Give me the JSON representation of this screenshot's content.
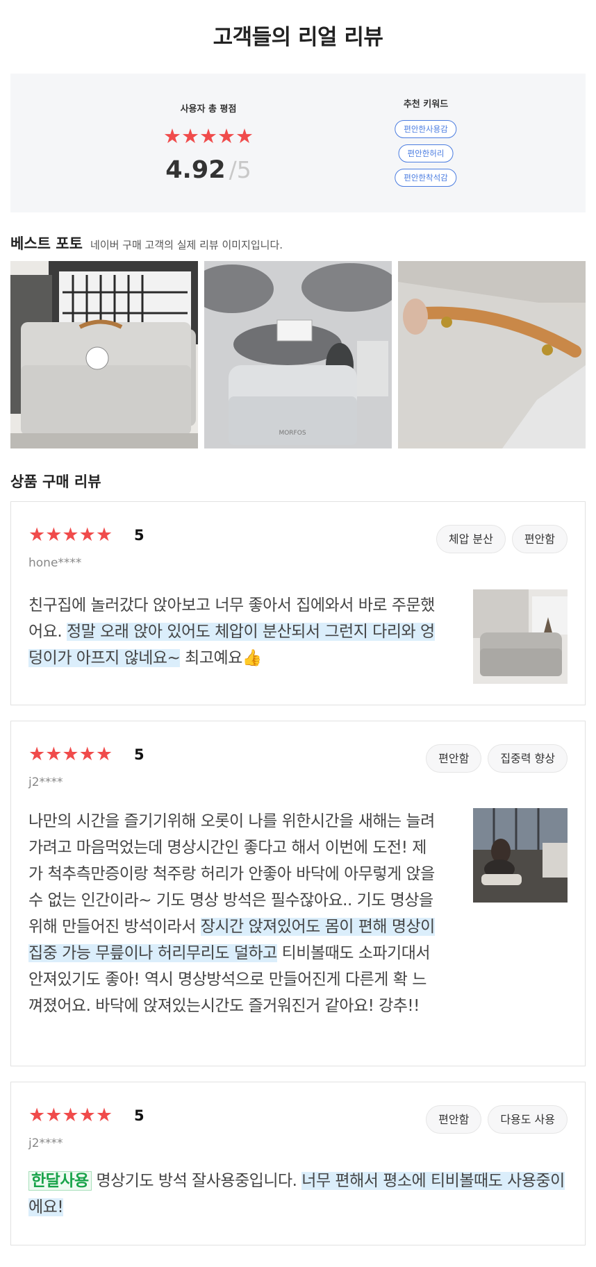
{
  "page": {
    "title": "고객들의 리얼 리뷰"
  },
  "summary": {
    "rating_label": "사용자 총 평점",
    "stars": "★★★★★",
    "score": "4.92",
    "score_sep": "/",
    "score_max": "5",
    "keywords_title": "추천 키워드",
    "keywords": [
      "편안한사용감",
      "편안한허리",
      "편안한착석감"
    ]
  },
  "best_photo": {
    "title": "베스트 포토",
    "subtitle": "네이버 구매 고객의 실제 리뷰 이미지입니다.",
    "photo_brand": "MORFOS"
  },
  "reviews_section": {
    "title": "상품 구매 리뷰"
  },
  "reviews": [
    {
      "stars": "★★★★★",
      "score": "5",
      "user": "hone****",
      "tags": [
        "체압 분산",
        "편안함"
      ],
      "text_plain_1": "친구집에 놀러갔다 앉아보고 너무 좋아서 집에와서 바로 주문했어요. ",
      "text_highlight_1": "정말 오래 앉아 있어도 체압이 분산되서 그런지 다리와 엉덩이가 아프지 않네요~",
      "text_plain_2": " 최고예요👍"
    },
    {
      "stars": "★★★★★",
      "score": "5",
      "user": "j2****",
      "tags": [
        "편안함",
        "집중력 향상"
      ],
      "text_plain_1": "나만의 시간을 즐기기위해 오롯이 나를 위한시간을 새해는 늘려가려고 마음먹었는데 명상시간인 좋다고 해서 이번에 도전! 제가 척추측만증이랑 척주랑 허리가 안좋아 바닥에 아무렇게 앉을수 없는 인간이라~ 기도 명상 방석은 필수잖아요.. 기도 명상을 위해 만들어진 방석이라서 ",
      "text_highlight_1": "장시간 앉져있어도 몸이 편해 명상이집중 가능 무릎이나 허리무리도 덜하고",
      "text_plain_2": " 티비볼때도 소파기대서 안져있기도 좋아! 역시 명상방석으로 만들어진게 다른게 확 느껴졌어요. 바닥에 앉져있는시간도 즐거워진거 같아요! 강추!!"
    },
    {
      "stars": "★★★★★",
      "score": "5",
      "user": "j2****",
      "tags": [
        "편안함",
        "다용도 사용"
      ],
      "badge": "한달사용",
      "text_plain_1": " 명상기도 방석 잘사용중입니다. ",
      "text_highlight_1": "너무 편해서 평소에 티비볼때도 사용중이에요!"
    }
  ]
}
